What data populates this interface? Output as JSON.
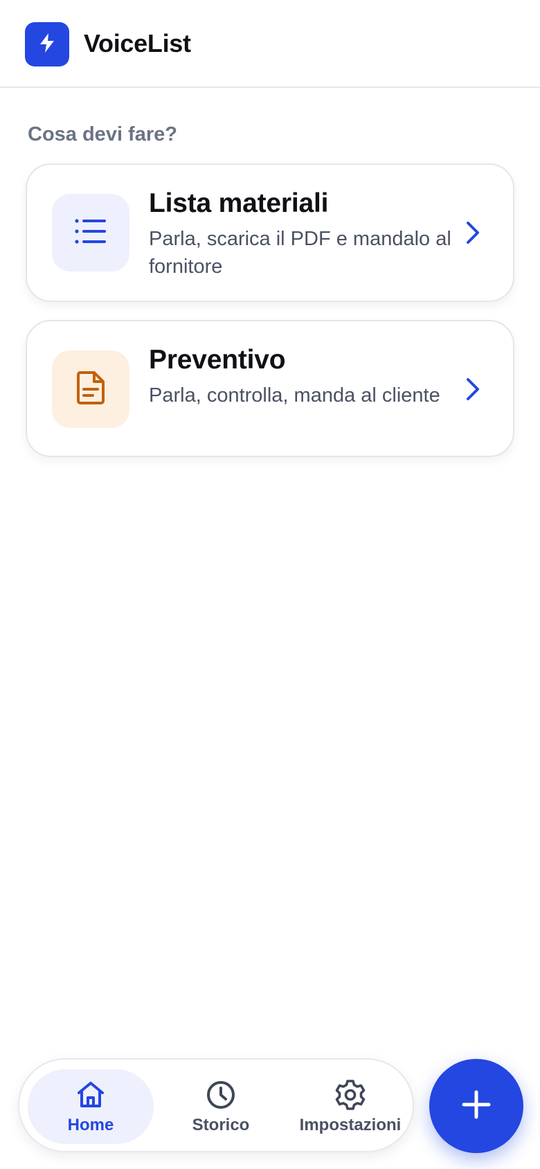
{
  "header": {
    "app_title": "VoiceList",
    "logo_icon": "lightning-bolt-icon"
  },
  "main": {
    "section_label": "Cosa devi fare?",
    "cards": [
      {
        "title": "Lista materiali",
        "description": "Parla, scarica il PDF e mandalo al fornitore",
        "icon": "list-icon",
        "icon_color": "#2347e0",
        "icon_bg": "#eef0fd"
      },
      {
        "title": "Preventivo",
        "description": "Parla, controlla, manda al cliente",
        "icon": "document-icon",
        "icon_color": "#c2610a",
        "icon_bg": "#fdf0e1"
      }
    ]
  },
  "bottom_nav": {
    "items": [
      {
        "label": "Home",
        "icon": "home-icon",
        "active": true
      },
      {
        "label": "Storico",
        "icon": "clock-icon",
        "active": false
      },
      {
        "label": "Impostazioni",
        "icon": "gear-icon",
        "active": false
      }
    ]
  },
  "fab": {
    "icon": "plus-icon"
  },
  "colors": {
    "accent": "#2347e0",
    "muted_text": "#6b7385",
    "body_text": "#4a5163"
  }
}
